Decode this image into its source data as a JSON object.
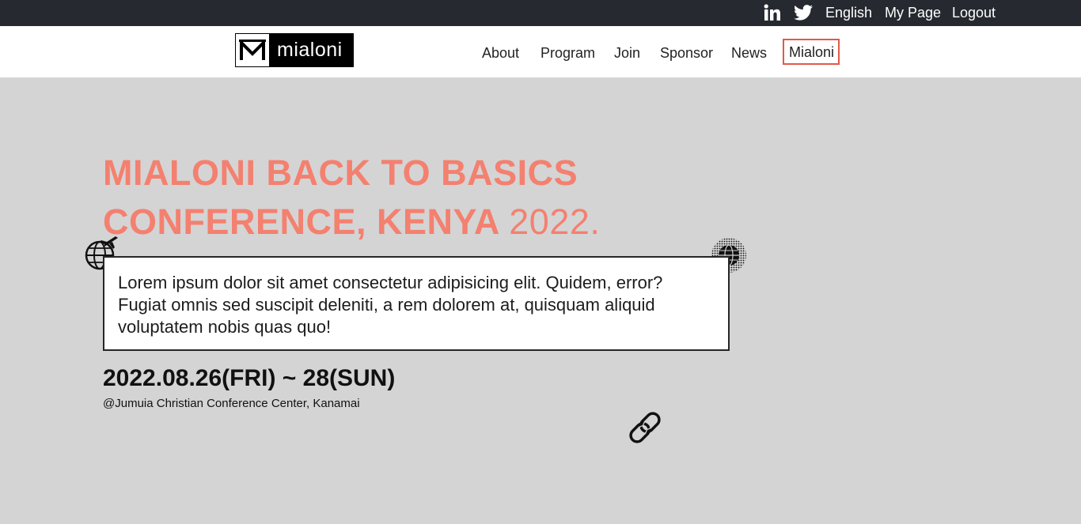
{
  "topbar": {
    "social_icons": [
      "linkedin-icon",
      "twitter-icon"
    ],
    "language": "English",
    "my_page": "My Page",
    "logout": "Logout"
  },
  "header": {
    "logo_text": "mialoni",
    "nav": [
      {
        "label": "About"
      },
      {
        "label": "Program"
      },
      {
        "label": "Join"
      },
      {
        "label": "Sponsor"
      },
      {
        "label": "News"
      },
      {
        "label": "Mialoni",
        "active": true
      }
    ]
  },
  "hero": {
    "title_line1": "MIALONI BACK TO BASICS",
    "title_line2": "CONFERENCE, KENYA",
    "title_year": "2022.",
    "description": "Lorem ipsum dolor sit amet consectetur adipisicing elit. Quidem, error? Fugiat omnis sed suscipit deleniti, a rem dolorem at, quisquam aliquid voluptatem nobis quas quo!",
    "date": "2022.08.26(FRI) ~ 28(SUN)",
    "venue": "@Jumuia Christian Conference Center, Kanamai",
    "icons": [
      "globe-plane-icon",
      "dotted-globe-icon",
      "chain-link-icon"
    ]
  },
  "colors": {
    "topbar_bg": "#262930",
    "hero_bg": "#d4d4d4",
    "title_accent": "#f4806f",
    "active_nav_border": "#e2584a"
  }
}
